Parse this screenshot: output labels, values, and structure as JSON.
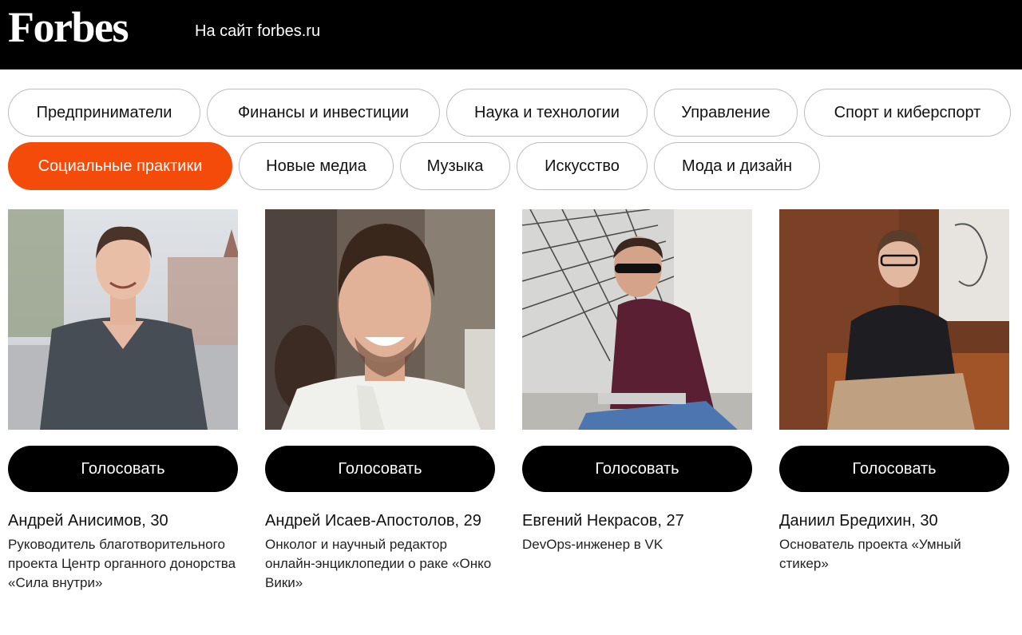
{
  "header": {
    "logo": "Forbes",
    "site_link": "На сайт forbes.ru"
  },
  "categories": {
    "row1": [
      "Предприниматели",
      "Финансы и инвестиции",
      "Наука и технологии",
      "Управление",
      "Спорт и киберспорт"
    ],
    "row2": [
      "Социальные практики",
      "Новые медиа",
      "Музыка",
      "Искусство",
      "Мода и дизайн"
    ],
    "active": "Социальные практики",
    "active_color": "#f44a0a"
  },
  "cards": [
    {
      "vote_label": "Голосовать",
      "name": "Андрей Анисимов, 30",
      "role": "Руководитель благотворительного проекта Центр органного донорства «Сила внутри»"
    },
    {
      "vote_label": "Голосовать",
      "name": "Андрей Исаев-Апостолов, 29",
      "role": "Онколог и научный редактор онлайн-энциклопедии о раке «Онко Вики»"
    },
    {
      "vote_label": "Голосовать",
      "name": "Евгений Некрасов, 27",
      "role": "DevOps-инженер в VK"
    },
    {
      "vote_label": "Голосовать",
      "name": "Даниил Бредихин, 30",
      "role": "Основатель проекта «Умный стикер»"
    }
  ]
}
